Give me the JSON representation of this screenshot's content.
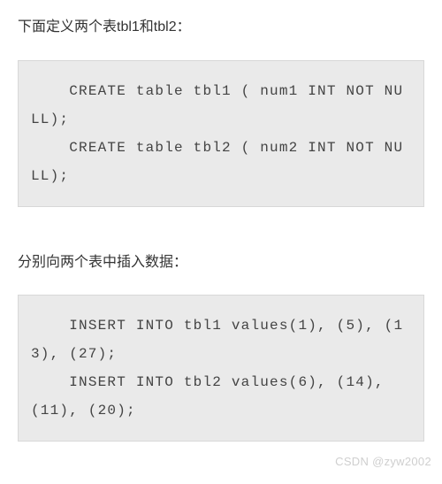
{
  "intro_text_1": "下面定义两个表tbl1和tbl2：",
  "code_block_1": "    CREATE table tbl1 ( num1 INT NOT NULL);\n    CREATE table tbl2 ( num2 INT NOT NULL);",
  "intro_text_2": "分别向两个表中插入数据：",
  "code_block_2": "    INSERT INTO tbl1 values(1), (5), (13), (27);\n    INSERT INTO tbl2 values(6), (14), (11), (20);",
  "watermark": "CSDN @zyw2002"
}
